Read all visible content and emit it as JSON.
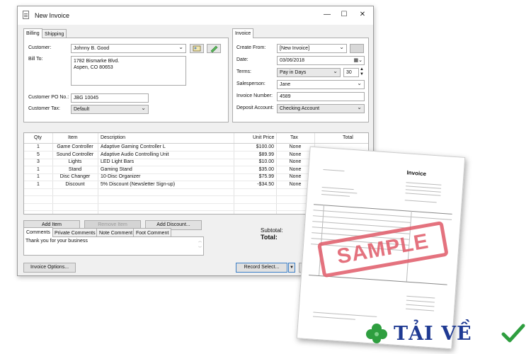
{
  "window": {
    "title": "New Invoice",
    "minimize": "—",
    "maximize": "☐",
    "close": "✕"
  },
  "billing_tabs": [
    "Billing",
    "Shipping"
  ],
  "billing": {
    "customer_label": "Customer:",
    "customer_value": "Johnny B. Good",
    "bill_to_label": "Bill To:",
    "bill_to_line1": "1782 Bismarke Blvd.",
    "bill_to_line2": "Aspen, CO 80653",
    "po_label": "Customer PO No.:",
    "po_value": "JBG 10045",
    "tax_label": "Customer Tax:",
    "tax_value": "Default"
  },
  "invoice_tab": "Invoice",
  "invoice": {
    "create_from_label": "Create From:",
    "create_from_value": "[New Invoice]",
    "date_label": "Date:",
    "date_value": "03/06/2018",
    "terms_label": "Terms:",
    "terms_value": "Pay in Days",
    "terms_days": "30",
    "salesperson_label": "Salesperson:",
    "salesperson_value": "Jane",
    "number_label": "Invoice Number:",
    "number_value": "4589",
    "deposit_label": "Deposit Account:",
    "deposit_value": "Checking Account"
  },
  "items": {
    "headers": {
      "qty": "Qty",
      "item": "Item",
      "description": "Description",
      "unit_price": "Unit Price",
      "tax": "Tax",
      "total": "Total"
    },
    "rows": [
      {
        "qty": "1",
        "item": "Game Controller",
        "description": "Adaptive Gaming Controller L",
        "unit_price": "$100.00",
        "tax": "None"
      },
      {
        "qty": "5",
        "item": "Sound Controller",
        "description": "Adaptive Audio Controlling Unit",
        "unit_price": "$89.99",
        "tax": "None"
      },
      {
        "qty": "3",
        "item": "Lights",
        "description": "LED Light Bars",
        "unit_price": "$10.00",
        "tax": "None"
      },
      {
        "qty": "1",
        "item": "Stand",
        "description": "Gaming Stand",
        "unit_price": "$35.00",
        "tax": "None"
      },
      {
        "qty": "1",
        "item": "Disc Changer",
        "description": "10-Disc Organizer",
        "unit_price": "$75.99",
        "tax": "None"
      },
      {
        "qty": "1",
        "item": "Discount",
        "description": "5% Discount (Newsletter Sign-up)",
        "unit_price": "-$34.50",
        "tax": "None"
      }
    ]
  },
  "buttons": {
    "add_item": "Add Item",
    "remove_item": "Remove Item",
    "add_discount": "Add Discount...",
    "invoice_options": "Invoice Options...",
    "record_select": "Record Select..."
  },
  "comment_tabs": [
    "Comments",
    "Private Comments",
    "Note Comment",
    "Foot Comment"
  ],
  "comments_text": "Thank you for your business",
  "totals": {
    "subtotal_label": "Subtotal:",
    "total_label": "Total:"
  },
  "preview": {
    "heading": "Invoice",
    "stamp": "SAMPLE"
  },
  "watermark": {
    "text": "TẢI VỀ",
    "colors": {
      "clover": "#2e9e3f",
      "text": "#1f3a93",
      "check": "#2e9e3f"
    }
  }
}
